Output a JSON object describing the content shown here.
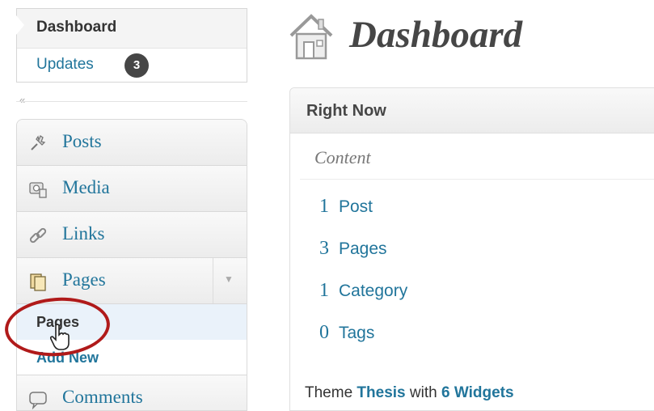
{
  "sidebar": {
    "dashboard_label": "Dashboard",
    "updates_label": "Updates",
    "updates_count": "3",
    "collapse_glyph": "«",
    "menu": [
      {
        "label": "Posts",
        "icon": "pushpin-icon"
      },
      {
        "label": "Media",
        "icon": "media-icon"
      },
      {
        "label": "Links",
        "icon": "links-icon"
      },
      {
        "label": "Pages",
        "icon": "pages-icon",
        "expanded": true
      },
      {
        "label": "Comments",
        "icon": "comments-icon"
      }
    ],
    "pages_submenu": {
      "current": "Pages",
      "add_new": "Add New"
    }
  },
  "main": {
    "title": "Dashboard",
    "right_now": {
      "title": "Right Now",
      "section": "Content",
      "stats": [
        {
          "count": "1",
          "label": "Post"
        },
        {
          "count": "3",
          "label": "Pages"
        },
        {
          "count": "1",
          "label": "Category"
        },
        {
          "count": "0",
          "label": "Tags"
        }
      ],
      "theme_prefix": "Theme",
      "theme_name": "Thesis",
      "theme_mid": "with",
      "widgets_text": "6 Widgets"
    }
  },
  "colors": {
    "link": "#21759b",
    "badge": "#464646",
    "annotation_circle": "#b01a1a",
    "current_submenu_bg": "#eaf2fa"
  }
}
